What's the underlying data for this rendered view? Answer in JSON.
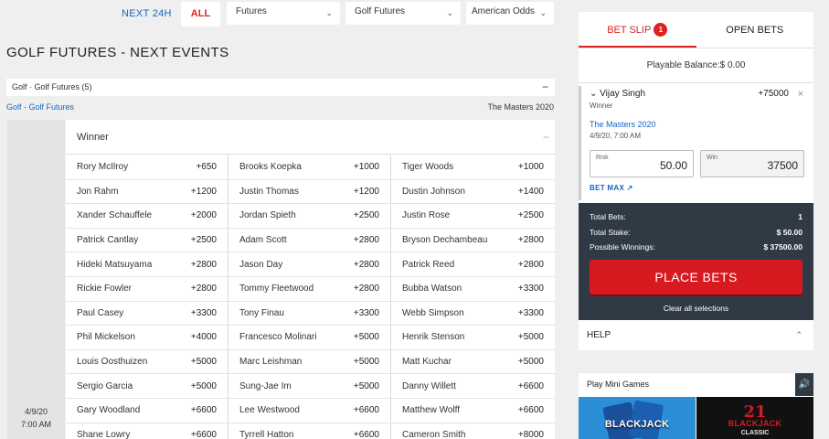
{
  "filters": {
    "next24_label": "NEXT 24H",
    "all_label": "ALL",
    "sport_select": "Futures",
    "league_select": "Golf Futures",
    "odds_select": "American Odds"
  },
  "page_title": "GOLF FUTURES - NEXT EVENTS",
  "breadcrumb": {
    "sport": "Golf",
    "separator": " - ",
    "league": "Golf Futures (5)",
    "collapse": "−"
  },
  "sublink": "Golf - Golf Futures",
  "event_name": "The Masters 2020",
  "event_date": "4/9/20",
  "event_time": "7:00 AM",
  "market": {
    "title": "Winner",
    "collapse": "−",
    "rows": [
      [
        [
          "Rory McIlroy",
          "+650"
        ],
        [
          "Brooks Koepka",
          "+1000"
        ],
        [
          "Tiger Woods",
          "+1000"
        ]
      ],
      [
        [
          "Jon Rahm",
          "+1200"
        ],
        [
          "Justin Thomas",
          "+1200"
        ],
        [
          "Dustin Johnson",
          "+1400"
        ]
      ],
      [
        [
          "Xander Schauffele",
          "+2000"
        ],
        [
          "Jordan Spieth",
          "+2500"
        ],
        [
          "Justin Rose",
          "+2500"
        ]
      ],
      [
        [
          "Patrick Cantlay",
          "+2500"
        ],
        [
          "Adam Scott",
          "+2800"
        ],
        [
          "Bryson Dechambeau",
          "+2800"
        ]
      ],
      [
        [
          "Hideki Matsuyama",
          "+2800"
        ],
        [
          "Jason Day",
          "+2800"
        ],
        [
          "Patrick Reed",
          "+2800"
        ]
      ],
      [
        [
          "Rickie Fowler",
          "+2800"
        ],
        [
          "Tommy Fleetwood",
          "+2800"
        ],
        [
          "Bubba Watson",
          "+3300"
        ]
      ],
      [
        [
          "Paul Casey",
          "+3300"
        ],
        [
          "Tony Finau",
          "+3300"
        ],
        [
          "Webb Simpson",
          "+3300"
        ]
      ],
      [
        [
          "Phil Mickelson",
          "+4000"
        ],
        [
          "Francesco Molinari",
          "+5000"
        ],
        [
          "Henrik Stenson",
          "+5000"
        ]
      ],
      [
        [
          "Louis Oosthuizen",
          "+5000"
        ],
        [
          "Marc Leishman",
          "+5000"
        ],
        [
          "Matt Kuchar",
          "+5000"
        ]
      ],
      [
        [
          "Sergio Garcia",
          "+5000"
        ],
        [
          "Sung-Jae Im",
          "+5000"
        ],
        [
          "Danny Willett",
          "+6600"
        ]
      ],
      [
        [
          "Gary Woodland",
          "+6600"
        ],
        [
          "Lee Westwood",
          "+6600"
        ],
        [
          "Matthew Wolff",
          "+6600"
        ]
      ],
      [
        [
          "Shane Lowry",
          "+6600"
        ],
        [
          "Tyrrell Hatton",
          "+6600"
        ],
        [
          "Cameron Smith",
          "+8000"
        ]
      ]
    ]
  },
  "betslip": {
    "tab_betslip": "BET SLIP",
    "badge_count": "1",
    "tab_openbets": "OPEN BETS",
    "balance": "Playable Balance:$ 0.00",
    "selection": {
      "player": "Vijay Singh",
      "market": "Winner",
      "price": "+75000",
      "event": "The Masters 2020",
      "datetime": "4/9/20, 7:00 AM",
      "risk_label": "Risk",
      "risk_value": "50.00",
      "win_label": "Win",
      "win_value": "37500",
      "betmax_label": "BET MAX"
    },
    "totals": {
      "total_bets_label": "Total Bets:",
      "total_bets_value": "1",
      "total_stake_label": "Total Stake:",
      "total_stake_value": "$ 50.00",
      "possible_label": "Possible Winnings:",
      "possible_value": "$ 37500.00"
    },
    "place_bets_label": "PLACE BETS",
    "clear_label": "Clear all selections"
  },
  "help_label": "HELP",
  "mini_games": {
    "title": "Play Mini Games",
    "game1": "BLACKJACK",
    "game2_num": "21",
    "game2_title": "BLACKJACK",
    "game2_sub": "CLASSIC"
  },
  "colors": {
    "accent_red": "#d71920",
    "link_blue": "#1565c0",
    "panel_dark": "#2f3a44"
  }
}
